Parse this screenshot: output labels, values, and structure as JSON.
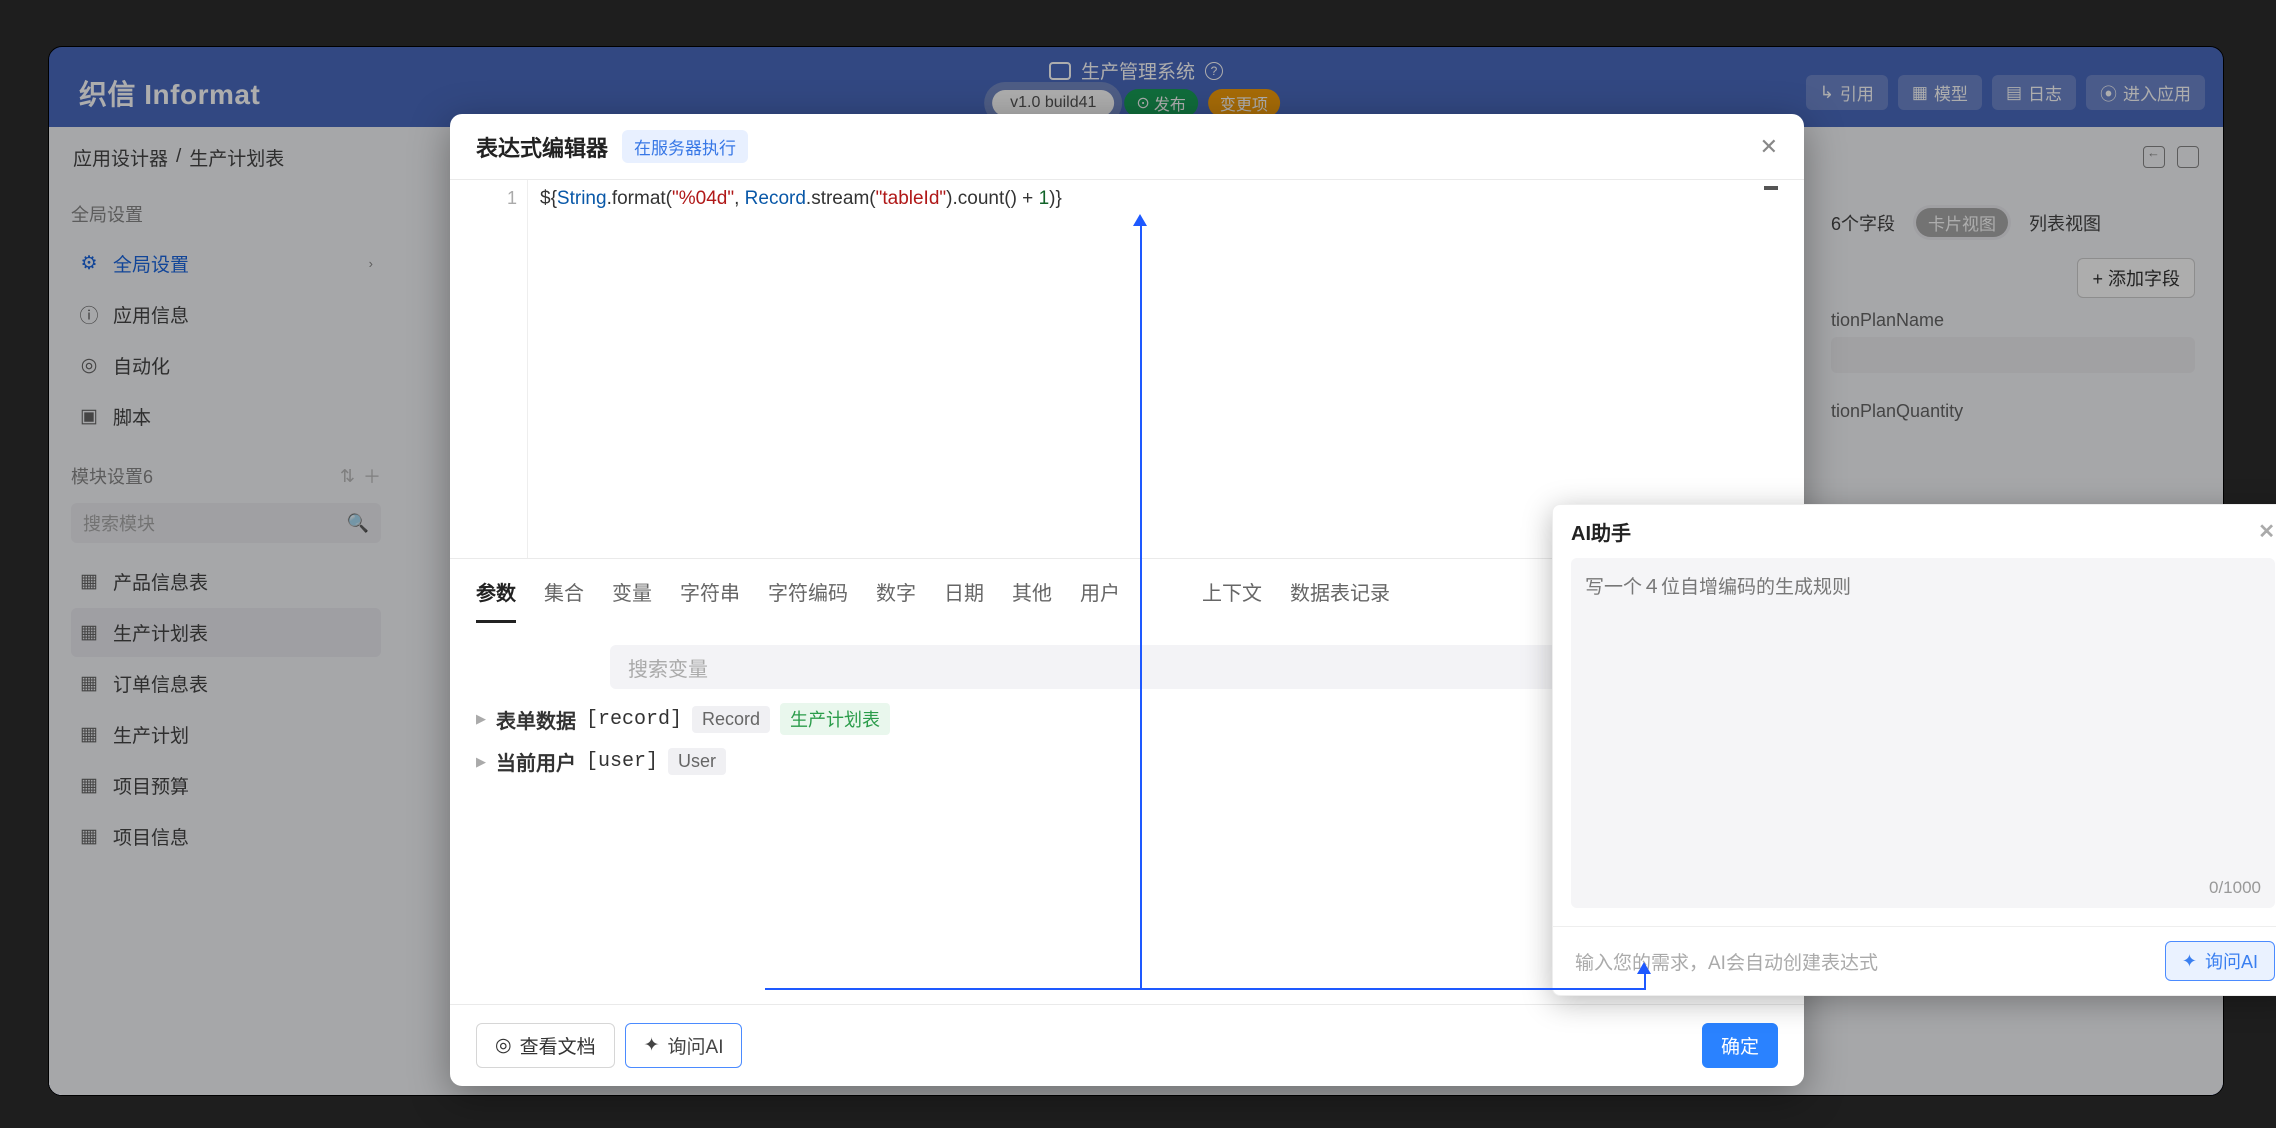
{
  "header": {
    "logo": "织信 Informat",
    "title": "生产管理系统",
    "version": "v1.0 build41",
    "publish_label": "发布",
    "changes_label": "变更项",
    "actions": {
      "quote": "引用",
      "model": "模型",
      "log": "日志",
      "enter_app": "进入应用"
    }
  },
  "breadcrumb": {
    "designer": "应用设计器",
    "page": "生产计划表"
  },
  "sidebar": {
    "global_section": "全局设置",
    "global_settings": "全局设置",
    "app_info": "应用信息",
    "automation": "自动化",
    "script": "脚本",
    "module_section": "模块设置6",
    "search_placeholder": "搜索模块",
    "items": [
      {
        "label": "产品信息表"
      },
      {
        "label": "生产计划表"
      },
      {
        "label": "订单信息表"
      },
      {
        "label": "生产计划"
      },
      {
        "label": "项目预算"
      },
      {
        "label": "项目信息"
      }
    ]
  },
  "rightpanel": {
    "fields_count": "6个字段",
    "seg_card": "卡片视图",
    "seg_list": "列表视图",
    "add_field": "+ 添加字段",
    "field1": "tionPlanName",
    "field2": "tionPlanQuantity"
  },
  "modal": {
    "title": "表达式编辑器",
    "tag": "在服务器执行",
    "code_line_no": "1",
    "code": {
      "p1": "${",
      "cls1": "String",
      "fn1": ".format(",
      "str1": "\"%04d\"",
      "sep": ", ",
      "cls2": "Record",
      "fn2": ".stream(",
      "str2": "\"tableId\"",
      "fn3": ").count() + ",
      "num": "1",
      "fn4": ")}"
    },
    "tabs": [
      "参数",
      "集合",
      "变量",
      "字符串",
      "字符编码",
      "数字",
      "日期",
      "其他",
      "用户",
      "上下文",
      "数据表记录"
    ],
    "search_var_placeholder": "搜索变量",
    "params": {
      "row1": {
        "tri": "▶",
        "lbl": "表单数据",
        "code": "[record]",
        "badge1": "Record",
        "badge2": "生产计划表"
      },
      "row2": {
        "tri": "▶",
        "lbl": "当前用户",
        "code": "[user]",
        "badge1": "User"
      }
    },
    "footer": {
      "doc": "查看文档",
      "ai": "询问AI",
      "ok": "确定"
    }
  },
  "ai": {
    "title": "AI助手",
    "placeholder_text": "写一个４位自增编码的生成规则",
    "counter": "0/1000",
    "input_placeholder": "输入您的需求，AI会自动创建表达式",
    "btn": "询问AI"
  }
}
